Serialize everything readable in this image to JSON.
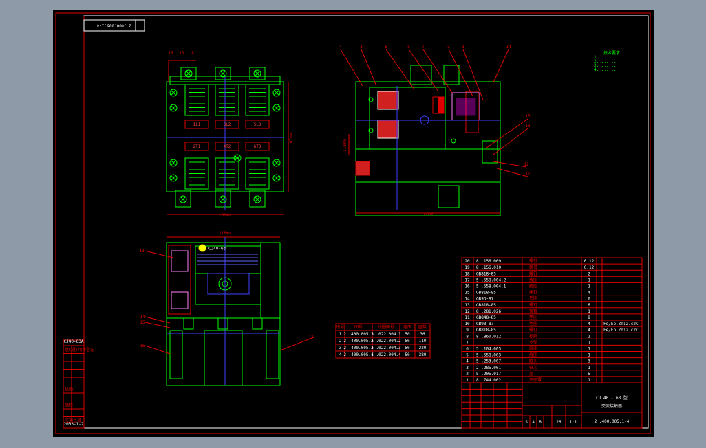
{
  "drawing": {
    "code_stamp": "2 .400.005.1-4",
    "title_line1": "CJ 40 - 63 型",
    "title_line2": "交流接触器",
    "drawing_number": "2 .400.005.1-4",
    "stage_letters": [
      "S",
      "A",
      "B"
    ],
    "sheet": "26",
    "scale": "1:1",
    "product_nameplate": "CJ40-63",
    "notes": [
      "技术要求",
      "1.  ......",
      "2.  ......",
      "3.  ......",
      "4.  ......"
    ]
  },
  "side_strip": {
    "top_label": "CJ40-63A",
    "bottom_label": "2003-1-2",
    "rows": [
      "借(通)用件登记",
      "",
      "",
      "",
      "",
      "描图",
      "",
      "描校",
      "",
      "底图总号"
    ]
  },
  "parts_list": {
    "rows": [
      {
        "no": "20",
        "code": "8 .156.009",
        "name": "螺钉",
        "qty": "0.12",
        "note": ""
      },
      {
        "no": "19",
        "code": "8 .156.010",
        "name": "螺母",
        "qty": "0.12",
        "note": ""
      },
      {
        "no": "18",
        "code": "GB818-85",
        "name": "螺钉",
        "qty": "2",
        "note": ""
      },
      {
        "no": "17",
        "code": "5 .558.004.2",
        "name": "线圈",
        "qty": "1",
        "note": ""
      },
      {
        "no": "16",
        "code": "5 .558.004.1",
        "name": "线圈",
        "qty": "1",
        "note": ""
      },
      {
        "no": "15",
        "code": "GB818-85",
        "name": "螺钉",
        "qty": "4",
        "note": ""
      },
      {
        "no": "14",
        "code": "GB93-87",
        "name": "垫圈",
        "qty": "6",
        "note": ""
      },
      {
        "no": "13",
        "code": "GB818-85",
        "name": "螺钉",
        "qty": "6",
        "note": ""
      },
      {
        "no": "12",
        "code": "8 .281.026",
        "name": "弹簧",
        "qty": "1",
        "note": ""
      },
      {
        "no": "11",
        "code": "GB848-85",
        "name": "垫圈",
        "qty": "8",
        "note": ""
      },
      {
        "no": "10",
        "code": "GB93-87",
        "name": "垫圈",
        "qty": "4",
        "note": "Fe/Ep.Zn12.c2C"
      },
      {
        "no": "9",
        "code": "GB818-85",
        "name": "螺钉",
        "qty": "4",
        "note": "Fe/Ep.Zn12.c2C"
      },
      {
        "no": "8",
        "code": "8 .860.012",
        "name": "标牌",
        "qty": "1",
        "note": ""
      },
      {
        "no": "7",
        "code": "",
        "name": "支架",
        "qty": "1",
        "note": ""
      },
      {
        "no": "6",
        "code": "5 .104.005",
        "name": "底座",
        "qty": "1",
        "note": ""
      },
      {
        "no": "5",
        "code": "5 .558.003",
        "name": "线圈",
        "qty": "1",
        "note": ""
      },
      {
        "no": "4",
        "code": "5 .253.007",
        "name": "触头",
        "qty": "3",
        "note": ""
      },
      {
        "no": "3",
        "code": "2 .285.001",
        "name": "铁芯",
        "qty": "1",
        "note": ""
      },
      {
        "no": "2",
        "code": "5 .205.017",
        "name": "盖",
        "qty": "5",
        "note": ""
      },
      {
        "no": "1",
        "code": "8 .744.002",
        "name": "灭弧罩",
        "qty": "1",
        "note": ""
      }
    ]
  },
  "variant_table": {
    "headers": [
      "序号",
      "图号",
      "线圈图号",
      "电压",
      "匝数"
    ],
    "rows": [
      [
        "1",
        "2 .400.005.1",
        "5 .022.004.1",
        "50",
        "36"
      ],
      [
        "2",
        "2 .400.005.2",
        "5 .022.004.2",
        "50",
        "110"
      ],
      [
        "3",
        "2 .400.005.3",
        "5 .022.004.3",
        "50",
        "220"
      ],
      [
        "4",
        "2 .400.005.4",
        "5 .022.004.4",
        "50",
        "380"
      ]
    ]
  },
  "labels": {
    "phases_top": [
      "1L1",
      "3L2",
      "5L3"
    ],
    "phases_bottom": [
      "2T1",
      "4T2",
      "6T3"
    ],
    "callouts_top_view": [
      "18",
      "10",
      "8"
    ],
    "callouts_side_view": [
      "4",
      "3",
      "6",
      "5",
      "7",
      "2",
      "1",
      "14",
      "15",
      "13",
      "12",
      "11"
    ],
    "callouts_front_view": [
      "13",
      "14",
      "15",
      "16",
      "17"
    ],
    "dim_labels": [
      "100mm",
      "67mm",
      "77mm",
      "110mm",
      "116mm"
    ]
  }
}
